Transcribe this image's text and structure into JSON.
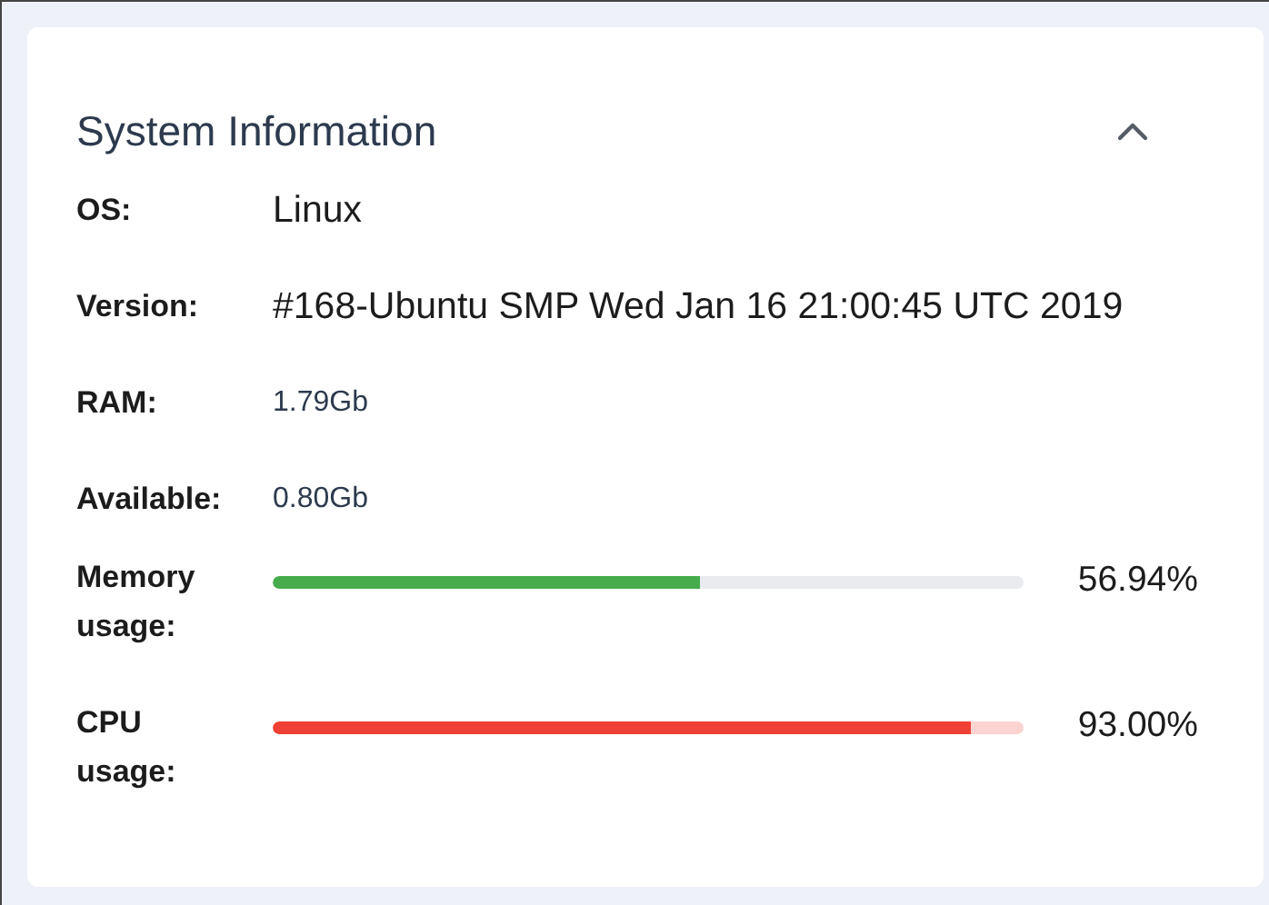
{
  "panel": {
    "title": "System Information",
    "expanded": true
  },
  "fields": [
    {
      "label": "OS:",
      "value": "Linux",
      "kind": "large"
    },
    {
      "label": "Version:",
      "value": "#168-Ubuntu SMP Wed Jan 16 21:00:45 UTC 2019",
      "kind": "large"
    },
    {
      "label": "RAM:",
      "value": "1.79Gb",
      "kind": "small"
    },
    {
      "label": "Available:",
      "value": "0.80Gb",
      "kind": "small"
    }
  ],
  "meters": [
    {
      "label": "Memory usage:",
      "level": 0.5694,
      "reading": "56.94%",
      "color": "#46ac4c",
      "critical": false
    },
    {
      "label": "CPU usage:",
      "level": 0.93,
      "reading": "93.00%",
      "color": "#ee4034",
      "critical": true
    }
  ]
}
